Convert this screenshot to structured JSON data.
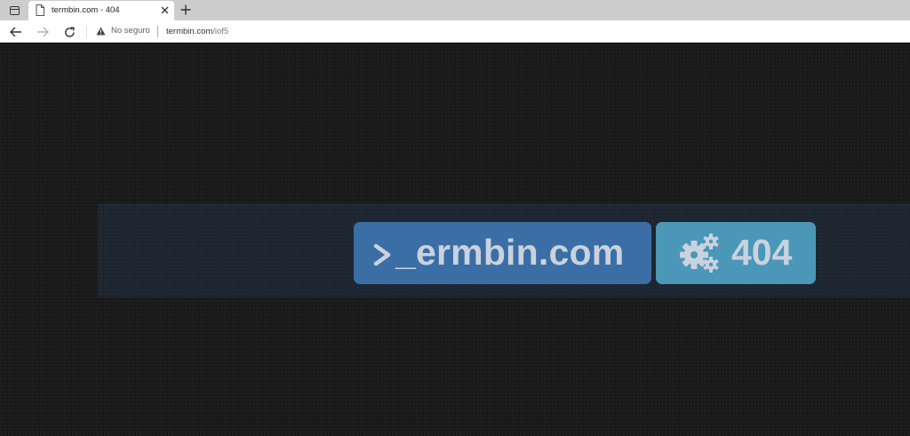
{
  "browser": {
    "tab": {
      "title": "termbin.com - 404",
      "favicon": "page-icon"
    },
    "address_bar": {
      "security_label": "No seguro",
      "url_host": "termbin.com",
      "url_path": "/iof5"
    },
    "icons": {
      "tab_actions": "tab-actions-icon",
      "close_tab": "close-icon",
      "new_tab": "plus-icon",
      "back": "arrow-left-icon",
      "forward": "arrow-right-icon",
      "reload": "reload-icon",
      "security": "warning-icon"
    }
  },
  "page": {
    "brand": {
      "text": "_ermbin.com",
      "prompt_icon": "prompt-chevron-icon",
      "color": "#3a6ea5"
    },
    "error": {
      "code": "404",
      "icon": "gears-icon",
      "color": "#4a97b8"
    },
    "text_color": "#c9d2dd",
    "background_color": "#1c1c1c"
  }
}
